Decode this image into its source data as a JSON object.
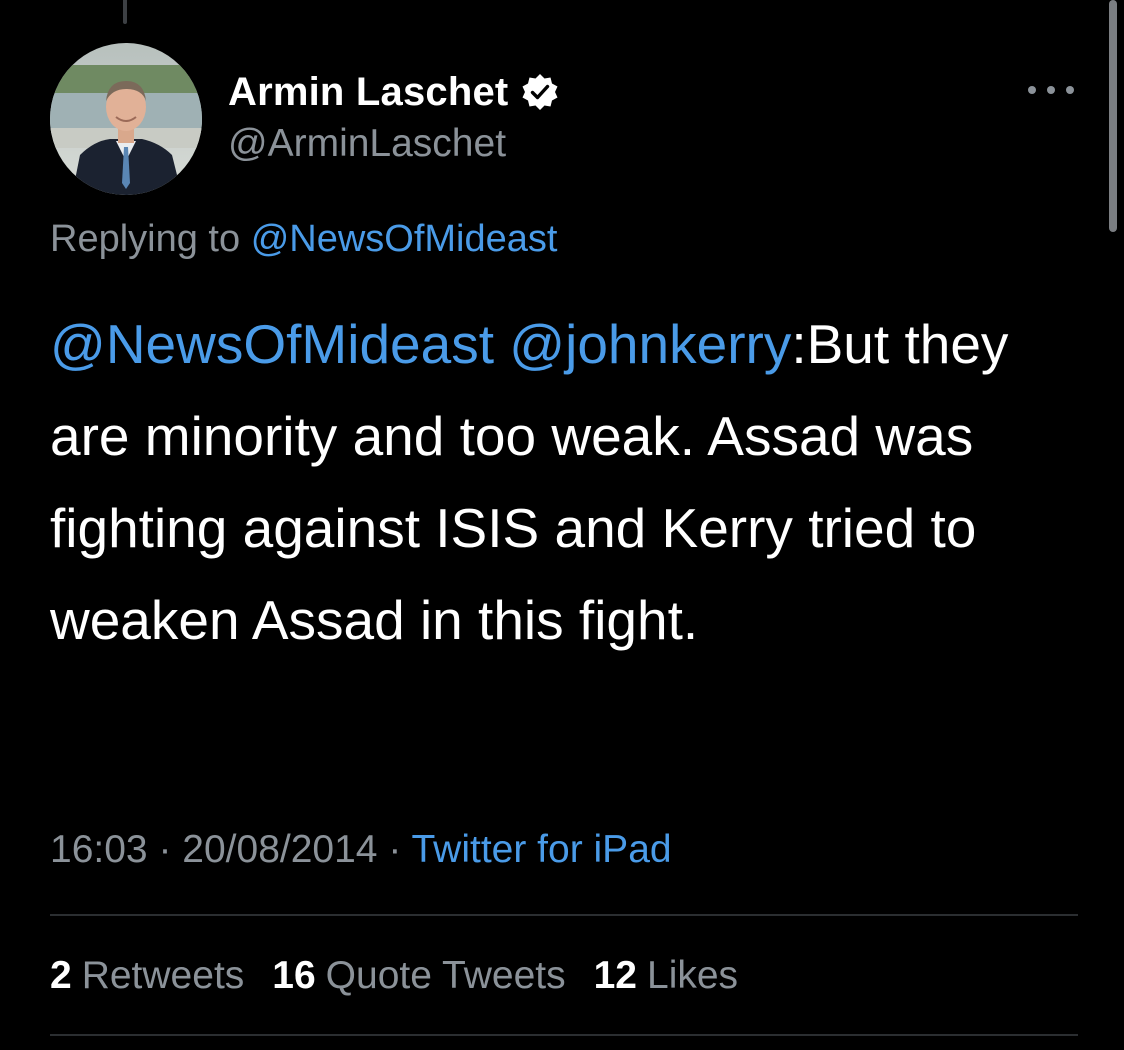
{
  "tweet": {
    "author": {
      "display_name": "Armin Laschet",
      "handle": "@ArminLaschet",
      "verified_icon": "verified-badge-icon"
    },
    "replying_prefix": "Replying to",
    "replying_to": "@NewsOfMideast",
    "body": {
      "mention_1": "@NewsOfMideast",
      "mention_2": "@johnkerry",
      "text": ":But they are minority and too weak. Assad was fighting against ISIS and Kerry tried to weaken Assad in this fight."
    },
    "time": "16:03",
    "separator": "·",
    "date": "20/08/2014",
    "source": "Twitter for iPad",
    "stats": {
      "retweets_count": "2",
      "retweets_label": "Retweets",
      "quotes_count": "16",
      "quotes_label": "Quote Tweets",
      "likes_count": "12",
      "likes_label": "Likes"
    }
  },
  "colors": {
    "background": "#000000",
    "primary_text": "#ffffff",
    "secondary_text": "#8b9299",
    "link": "#4a9be8",
    "divider": "#2b2e31"
  }
}
